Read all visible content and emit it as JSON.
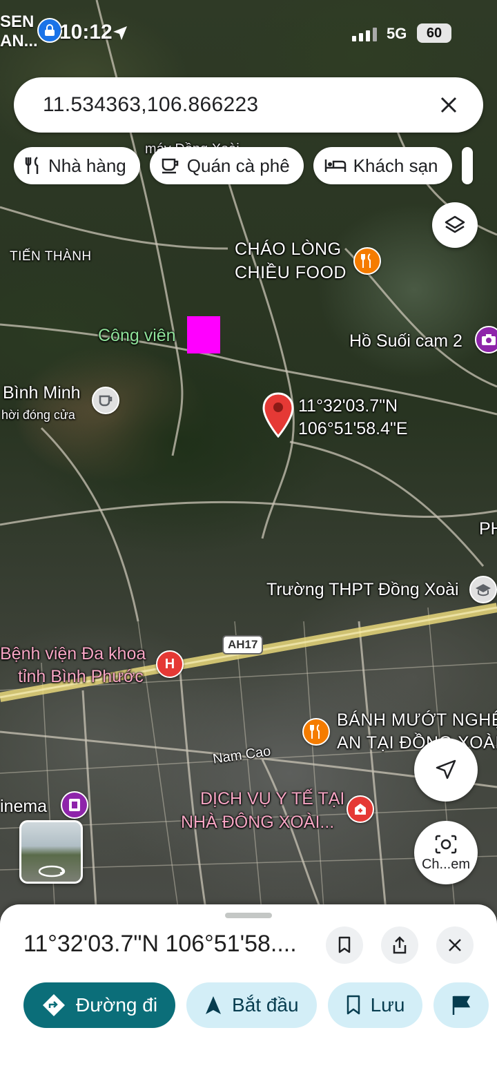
{
  "status_bar": {
    "left_text_line1": "SEN",
    "left_text_line2": "AN...",
    "time": "10:12",
    "network": "5G",
    "battery": "60"
  },
  "search": {
    "value": "11.534363,106.866223"
  },
  "chips": [
    {
      "label": "Nhà hàng",
      "icon": "fork-knife-icon"
    },
    {
      "label": "Quán cà phê",
      "icon": "coffee-cup-icon"
    },
    {
      "label": "Khách sạn",
      "icon": "bed-icon"
    }
  ],
  "map": {
    "labels": {
      "tien_thanh": "TIẾN THÀNH",
      "chao_long_1": "CHÁO LÒNG",
      "chao_long_2": "CHIỀU FOOD",
      "cong_vien": "Công viên",
      "ho_suoi": "Hồ Suối cam 2",
      "binh_minh": "Bình Minh",
      "binh_minh_status": "hời đóng cửa",
      "coord_lat": "11°32'03.7\"N",
      "coord_lng": "106°51'58.4\"E",
      "truong_thpt": "Trường THPT Đồng Xoài",
      "ph_edge": "PH",
      "highway": "AH17",
      "benh_vien_1": "Bệnh viện Đa khoa",
      "benh_vien_2": "tỉnh Bình Phước",
      "banh_muot_1": "BÁNH MƯỚT NGHỆ",
      "banh_muot_2": "AN TẠI ĐỒNG XOÀI",
      "nam_cao": "Nam Cao",
      "cinema": "inema",
      "dich_vu_1": "DỊCH VỤ Y TẾ TẠI",
      "dich_vu_2": "NHÀ ĐÔNG XOÀI...",
      "blurred_top": "máy Đồng Xoài"
    },
    "lens_label": "Ch...em"
  },
  "sheet": {
    "title": "11°32'03.7\"N 106°51'58....",
    "actions": [
      {
        "label": "Đường đi",
        "icon": "directions-icon"
      },
      {
        "label": "Bắt đầu",
        "icon": "navigation-arrow-icon"
      },
      {
        "label": "Lưu",
        "icon": "bookmark-icon"
      }
    ]
  },
  "colors": {
    "primary_action": "#0b6e79",
    "secondary_action": "#d3eef7",
    "pin": "#e53935",
    "marker_box": "#ff00ff"
  }
}
